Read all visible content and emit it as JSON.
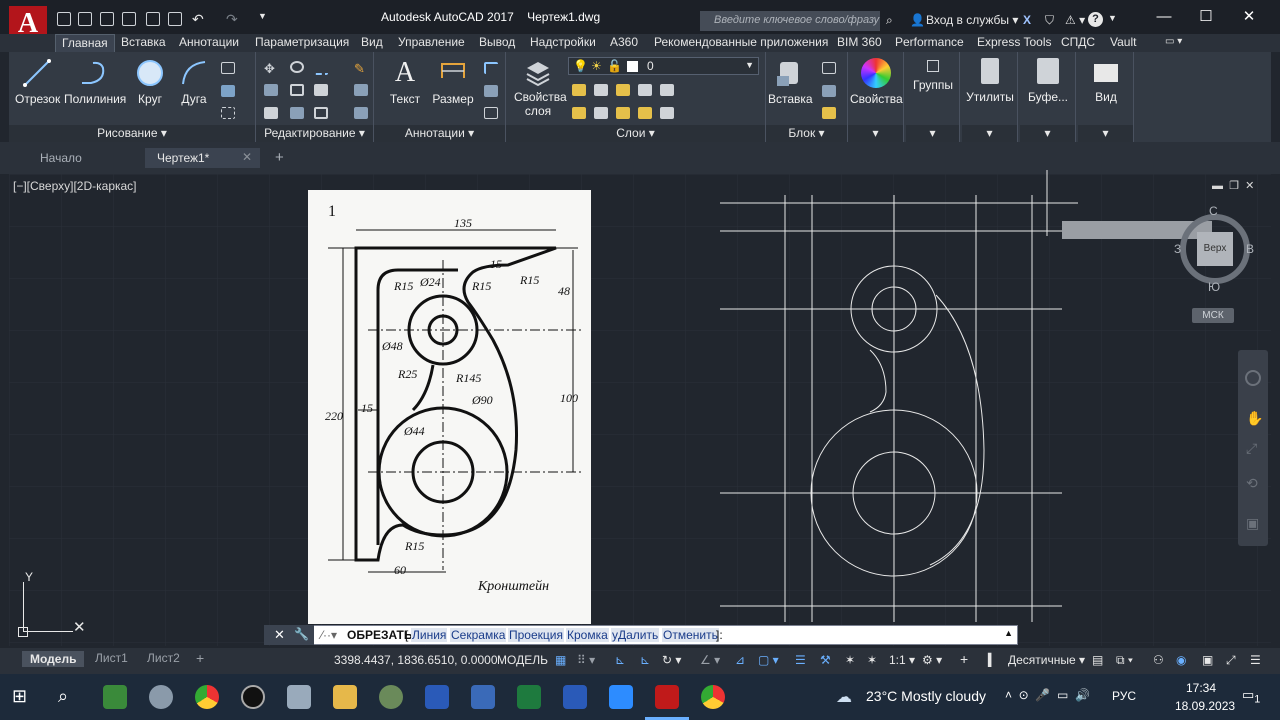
{
  "app": {
    "title": "Autodesk AutoCAD 2017",
    "file": "Чертеж1.dwg",
    "logo": "A",
    "search_placeholder": "Введите ключевое слово/фразу",
    "signin": "Вход в службы"
  },
  "tabs": [
    "Главная",
    "Вставка",
    "Аннотации",
    "Параметризация",
    "Вид",
    "Управление",
    "Вывод",
    "Надстройки",
    "А360",
    "Рекомендованные приложения",
    "BIM 360",
    "Performance",
    "Express Tools",
    "СПДС",
    "Vault"
  ],
  "ribbon": {
    "draw": {
      "tools": [
        "Отрезок",
        "Полилиния",
        "Круг",
        "Дуга"
      ],
      "title": "Рисование"
    },
    "modify": {
      "title": "Редактирование"
    },
    "annot": {
      "tools": [
        "Текст",
        "Размер"
      ],
      "title": "Аннотации"
    },
    "layers": {
      "tool": "Свойства слоя",
      "layer_value": "0",
      "title": "Слои"
    },
    "block": {
      "tool": "Вставка",
      "title": "Блок"
    },
    "props": "Свойства",
    "groups": "Группы",
    "utils": "Утилиты",
    "clip": "Буфе...",
    "view": "Вид"
  },
  "doc_tabs": {
    "start": "Начало",
    "active": "Чертеж1*"
  },
  "viewport_label": "[−][Сверху][2D-каркас]",
  "viewcube": {
    "n": "С",
    "w": "З",
    "e": "В",
    "s": "Ю",
    "face": "Верх",
    "wcs": "МСК"
  },
  "ref_drawing": {
    "num": "1",
    "dims": [
      "135",
      "15",
      "R15",
      "48",
      "R15",
      "Ø24",
      "R15",
      "Ø48",
      "R25",
      "R145",
      "Ø90",
      "100",
      "220",
      "15",
      "Ø44",
      "R15",
      "60"
    ],
    "caption": "Кронштейн"
  },
  "ucs": {
    "y": "Y"
  },
  "command": {
    "name": "ОБРЕЗАТЬ",
    "open": "[",
    "options": [
      "Линия",
      "Секрамка",
      "Проекция",
      "Кромка",
      "уДалить",
      "Отменить"
    ],
    "close": "]:"
  },
  "status": {
    "tabs": [
      "Модель",
      "Лист1",
      "Лист2"
    ],
    "coords": "3398.4437, 1836.6510, 0.0000",
    "space": "МОДЕЛЬ",
    "scale": "1:1",
    "units": "Десятичные"
  },
  "taskbar": {
    "weather": "23°C  Mostly cloudy",
    "lang": "РУС",
    "time": "17:34",
    "date": "18.09.2023",
    "notif": "1"
  }
}
